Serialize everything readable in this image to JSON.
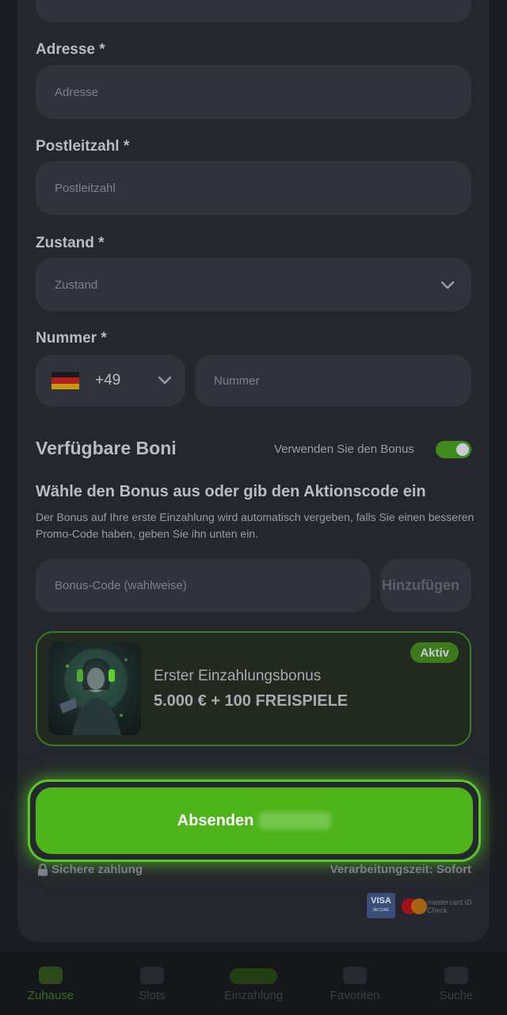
{
  "form": {
    "address_label": "Adresse *",
    "address_placeholder": "Adresse",
    "zip_label": "Postleitzahl *",
    "zip_placeholder": "Postleitzahl",
    "state_label": "Zustand *",
    "state_value": "Zustand",
    "phone_label": "Nummer *",
    "phone_code": "+49",
    "phone_placeholder": "Nummer"
  },
  "bonus": {
    "section_title": "Verfügbare Boni",
    "toggle_label": "Verwenden Sie den Bonus",
    "toggle_on": true,
    "choose_title": "Wähle den Bonus aus oder gib den Aktionscode ein",
    "choose_desc": "Der Bonus auf Ihre erste Einzahlung wird automatisch vergeben, falls Sie einen besseren Promo-Code haben, geben Sie ihn unten ein.",
    "code_placeholder": "Bonus-Code (wahlweise)",
    "add_label": "Hinzufügen",
    "card": {
      "badge": "Aktiv",
      "name": "Erster Einzahlungsbonus",
      "amount": "5.000 € + 100 FREISPIELE"
    }
  },
  "submit": {
    "label": "Absenden"
  },
  "footer": {
    "secure_label": "Sichere zahlung",
    "processing_label": "Verarbeitungszeit: Sofort",
    "visa_label": "VISA",
    "visa_sub": "SECURE",
    "mc_label": "mastercard ID Check"
  },
  "nav": {
    "items": [
      {
        "label": "Zuhause",
        "icon": "home-icon"
      },
      {
        "label": "Slots",
        "icon": "slots-icon"
      },
      {
        "label": "Einzahlung",
        "icon": "deposit-icon"
      },
      {
        "label": "Favoriten",
        "icon": "heart-icon"
      },
      {
        "label": "Suche",
        "icon": "search-icon"
      }
    ]
  },
  "colors": {
    "accent": "#4db51a",
    "panel": "#25272e",
    "input": "#30333c"
  }
}
